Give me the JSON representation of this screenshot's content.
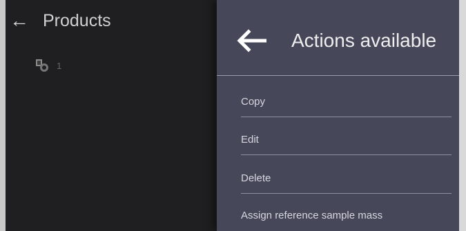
{
  "base_screen": {
    "back_label": "←",
    "title": "Products",
    "product_label": "1"
  },
  "panel": {
    "title": "Actions available",
    "back_icon": "arrow-left-icon",
    "items": [
      {
        "label": "Copy"
      },
      {
        "label": "Edit"
      },
      {
        "label": "Delete"
      },
      {
        "label": "Assign reference sample mass"
      }
    ]
  },
  "colors": {
    "background": "#1f1f21",
    "panel": "#46485a",
    "divider": "#8d8fa2"
  }
}
